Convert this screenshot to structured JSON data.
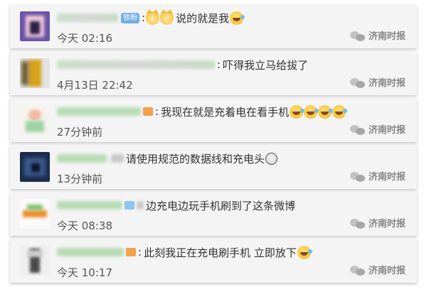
{
  "comments": [
    {
      "comment": "说的就是我",
      "time": "今天 02:16",
      "badge": "铁粉",
      "source": "济南时报"
    },
    {
      "comment": "吓得我立马给拔了",
      "time": "4月13日 22:42",
      "source": "济南时报"
    },
    {
      "comment": "我现在就是充着电在看手机",
      "time": "27分钟前",
      "source": "济南时报"
    },
    {
      "comment": "请使用规范的数据线和充电头",
      "time": "13分钟前",
      "source": "济南时报"
    },
    {
      "comment": "边充电边玩手机刷到了这条微博",
      "time": "今天 08:38",
      "source": "济南时报"
    },
    {
      "comment": "此刻我正在充电刷手机 立即放下",
      "time": "今天 10:17",
      "source": "济南时报"
    }
  ],
  "separator": ":",
  "colors": {
    "card_bg": "#f4f4f4",
    "text": "#333333",
    "time": "#555555",
    "badge_bg": "#74aee6",
    "watermark": "#7a7a7a"
  },
  "icons": {
    "emoji_laugh": "laughing-tears-emoji",
    "emoji_cat": "cat-face-emoji",
    "emoji_scream": "screaming-face-emoji",
    "watermark": "wechat-logo-icon"
  }
}
